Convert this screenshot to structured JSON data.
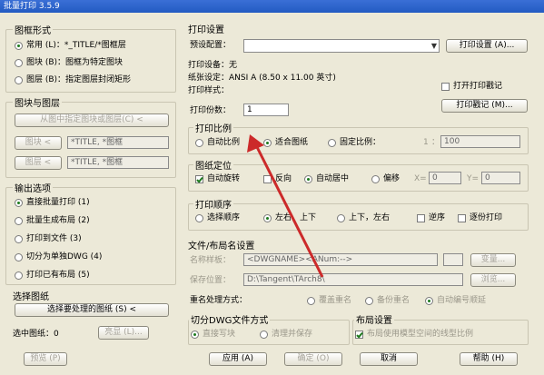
{
  "window": {
    "title": "批量打印 3.5.9"
  },
  "frame_shape": {
    "title": "图框形式",
    "options": [
      "常用 (L)：*_TITLE/*图框层",
      "图块 (B)：图框为特定图块",
      "图层 (B)：指定图层封闭矩形"
    ],
    "selected": 0
  },
  "block_layer": {
    "title": "图块与图层",
    "pick_button": "从图中指定图块或图层(C) <",
    "block_button": "图块 <",
    "block_value": "*TITLE, *图框",
    "layer_button": "图层 <",
    "layer_value": "*TITLE, *图框"
  },
  "output": {
    "title": "输出选项",
    "options": [
      "直接批量打印 (1)",
      "批量生成布局 (2)",
      "打印到文件 (3)",
      "切分为单独DWG (4)",
      "打印已有布局 (5)"
    ],
    "selected": 0
  },
  "select": {
    "title": "选择图纸",
    "button": "选择要处理的图纸 (S) <",
    "selected_label": "选中图纸：0",
    "highlight_button": "亮显 (L)..."
  },
  "print_settings": {
    "title": "打印设置",
    "preset_label": "预设配置：",
    "preset_value": "",
    "setup_button": "打印设置 (A)...",
    "device": "打印设备：无",
    "paper": "纸张设定：ANSI A (8.50 x 11.00 英寸)",
    "style": "打印样式：",
    "stamp_check": "打开打印戳记",
    "stamp_button": "打印戳记 (M)...",
    "copies_label": "打印份数：",
    "copies_value": "1"
  },
  "scale": {
    "title": "打印比例",
    "options": [
      "自动比例",
      "适合图纸",
      "固定比例："
    ],
    "selected": 1,
    "ratio_left": "1",
    "ratio_sep": "：",
    "ratio_right": "100"
  },
  "position": {
    "title": "图纸定位",
    "auto_rotate": "自动旋转",
    "reverse": "反向",
    "center": "自动居中",
    "offset": "偏移",
    "x_label": "X=",
    "x_value": "0",
    "y_label": "Y=",
    "y_value": "0"
  },
  "order": {
    "title": "打印顺序",
    "options": [
      "选择顺序",
      "左右，上下",
      "上下，左右"
    ],
    "selected": 1,
    "reverse": "逆序",
    "one_by_one": "逐份打印"
  },
  "naming": {
    "title": "文件/布局名设置",
    "name_label": "名称样板：",
    "name_value": "<DWGNAME><ANum:-->",
    "change_button": "变量...",
    "save_label": "保存位置：",
    "save_value": "D:\\Tangent\\TArch8\\",
    "browse_button": "浏览..."
  },
  "dup": {
    "label": "重名处理方式：",
    "options": [
      "覆盖重名",
      "备份重名",
      "自动编号顺延"
    ],
    "selected": 2
  },
  "split": {
    "title": "切分DWG文件方式",
    "options": [
      "直接写块",
      "清理并保存"
    ],
    "selected": 0
  },
  "layout": {
    "title": "布局设置",
    "check": "布局使用模型空间的线型比例"
  },
  "footer": {
    "preview": "预览 (P)",
    "apply": "应用 (A)",
    "ok": "确定 (O)",
    "cancel": "取消",
    "help": "帮助 (H)"
  },
  "colors": {
    "arrow": "#cc2a2a",
    "title_bar": "#2f65cc",
    "dialog_bg": "#ece9d8"
  }
}
